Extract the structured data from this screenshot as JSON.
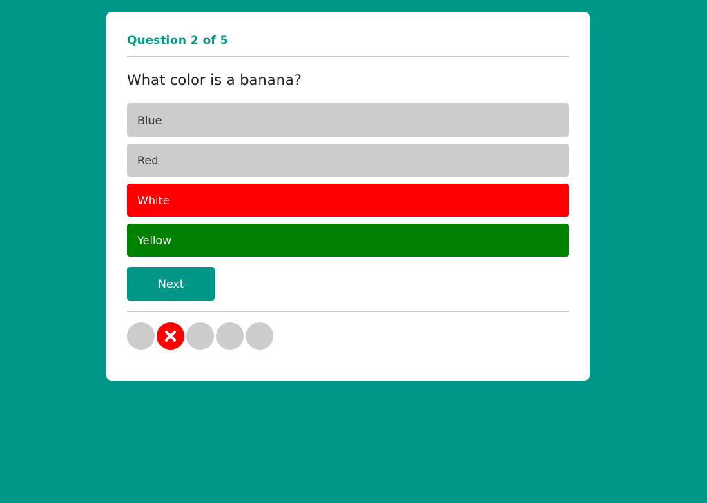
{
  "quiz": {
    "progress_label": "Question 2 of 5",
    "question": "What color is a banana?",
    "answers": [
      {
        "label": "Blue",
        "state": "neutral"
      },
      {
        "label": "Red",
        "state": "neutral"
      },
      {
        "label": "White",
        "state": "wrong"
      },
      {
        "label": "Yellow",
        "state": "correct"
      }
    ],
    "next_label": "Next",
    "progress_dots": [
      {
        "status": "unanswered"
      },
      {
        "status": "wrong",
        "icon": "close-icon"
      },
      {
        "status": "unanswered"
      },
      {
        "status": "unanswered"
      },
      {
        "status": "unanswered"
      }
    ]
  },
  "colors": {
    "background": "#009688",
    "accent": "#009688",
    "wrong": "#ff0000",
    "correct": "#008000",
    "neutral": "#cccccc"
  }
}
